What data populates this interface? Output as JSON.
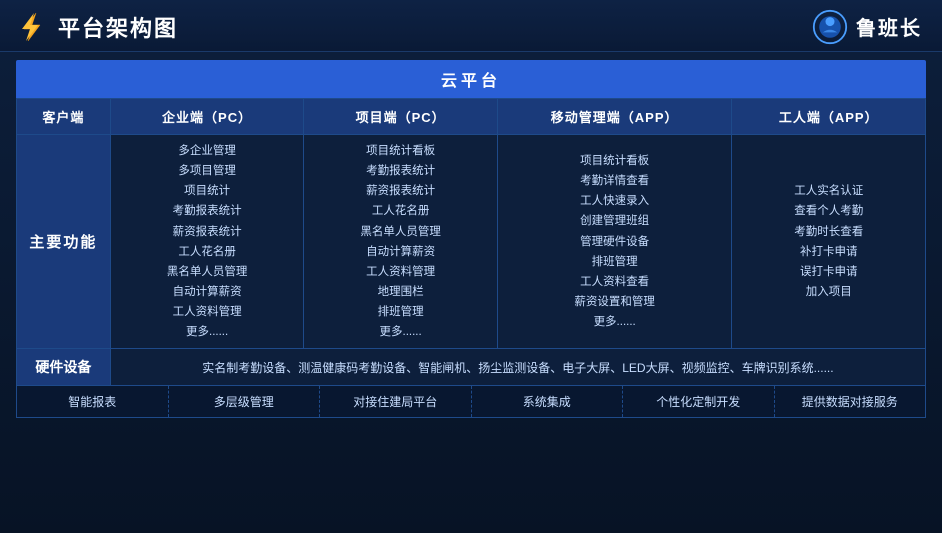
{
  "header": {
    "title": "平台架构图",
    "brand_name": "鲁班长"
  },
  "cloud_platform": {
    "label": "云平台"
  },
  "columns": {
    "client": "客户端",
    "enterprise_pc": "企业端（PC）",
    "project_pc": "项目端（PC）",
    "mobile_app": "移动管理端（APP）",
    "worker_app": "工人端（APP）"
  },
  "rows": {
    "main_features": {
      "label": "主要功能",
      "enterprise_list": [
        "多企业管理",
        "多项目管理",
        "项目统计",
        "考勤报表统计",
        "薪资报表统计",
        "工人花名册",
        "黑名单人员管理",
        "自动计算薪资",
        "工人资料管理",
        "更多......"
      ],
      "project_list": [
        "项目统计看板",
        "考勤报表统计",
        "薪资报表统计",
        "工人花名册",
        "黑名单人员管理",
        "自动计算薪资",
        "工人资料管理",
        "地理围栏",
        "排班管理",
        "更多......"
      ],
      "mobile_list": [
        "项目统计看板",
        "考勤详情查看",
        "工人快速录入",
        "创建管理班组",
        "管理硬件设备",
        "排班管理",
        "工人资料查看",
        "薪资设置和管理",
        "更多......"
      ],
      "worker_list": [
        "工人实名认证",
        "查看个人考勤",
        "考勤时长查看",
        "补打卡申请",
        "误打卡申请",
        "加入项目"
      ]
    }
  },
  "hardware": {
    "label": "硬件设备",
    "content": "实名制考勤设备、测温健康码考勤设备、智能闸机、扬尘监测设备、电子大屏、LED大屏、视频监控、车牌识别系统......"
  },
  "bottom_features": [
    "智能报表",
    "多层级管理",
    "对接住建局平台",
    "系统集成",
    "个性化定制开发",
    "提供数据对接服务"
  ]
}
